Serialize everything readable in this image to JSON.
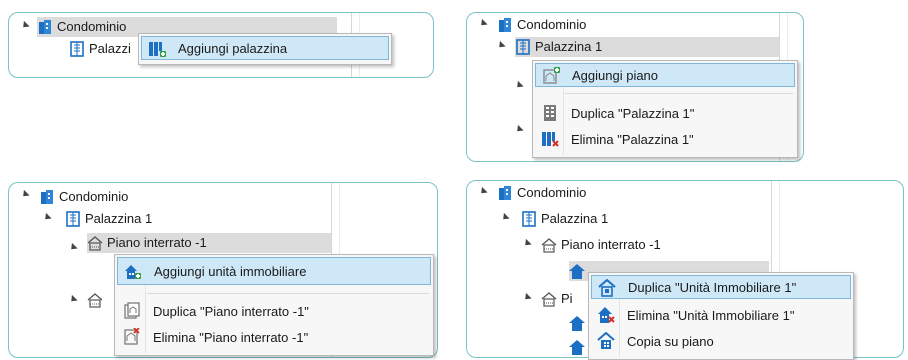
{
  "icons": {
    "condominio": "building-icon",
    "palazzina": "tower-building-icon",
    "piano": "floor-house-icon",
    "unita": "house-unit-icon"
  },
  "colors": {
    "accent_blue": "#1d6fc4",
    "highlight_bg": "#cfe8f7",
    "highlight_border": "#7fb6dd",
    "add_green": "#2ea043",
    "delete_red": "#d93025",
    "panel_border": "#7cc3c7"
  },
  "panel1": {
    "tree": {
      "condominio": "Condominio",
      "palazzina_partial": "Palazzi"
    },
    "menu": {
      "add_building": "Aggiungi palazzina"
    }
  },
  "panel2": {
    "tree": {
      "condominio": "Condominio",
      "palazzina": "Palazzina 1"
    },
    "menu": {
      "add_floor": "Aggiungi piano",
      "duplicate": "Duplica \"Palazzina 1\"",
      "delete": "Elimina \"Palazzina 1\""
    }
  },
  "panel3": {
    "tree": {
      "condominio": "Condominio",
      "palazzina": "Palazzina 1",
      "piano": "Piano interrato -1"
    },
    "menu": {
      "add_unit": "Aggiungi unità immobiliare",
      "duplicate": "Duplica \"Piano interrato -1\"",
      "delete": "Elimina \"Piano interrato -1\""
    }
  },
  "panel4": {
    "tree": {
      "condominio": "Condominio",
      "palazzina": "Palazzina 1",
      "piano": "Piano interrato -1",
      "piano2_partial": "Pi"
    },
    "menu": {
      "duplicate": "Duplica \"Unità Immobiliare 1\"",
      "delete": "Elimina \"Unità Immobiliare 1\"",
      "copy": "Copia su piano"
    }
  }
}
